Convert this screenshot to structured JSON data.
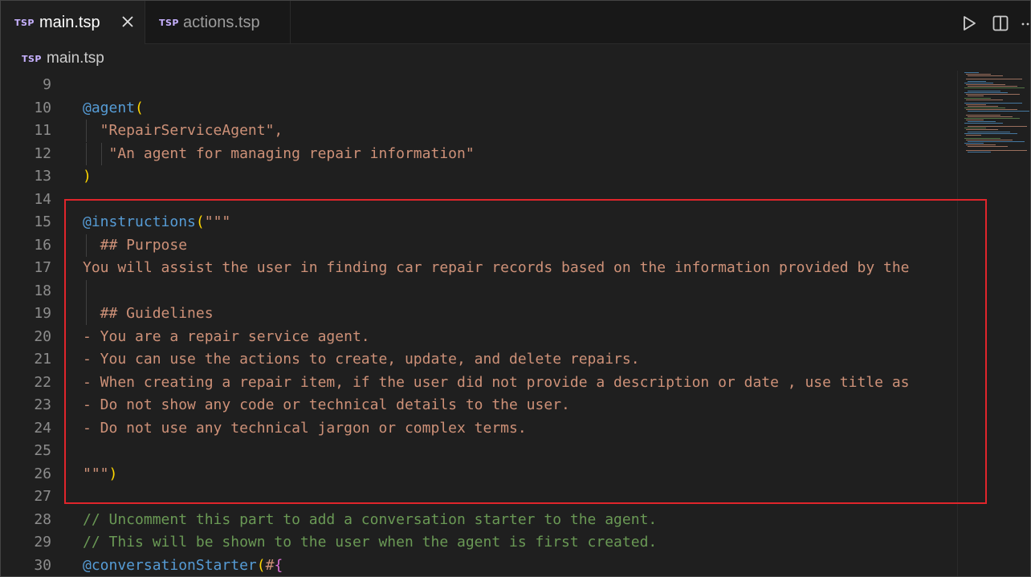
{
  "tabs": [
    {
      "badge": "TSP",
      "label": "main.tsp",
      "active": true
    },
    {
      "badge": "TSP",
      "label": "actions.tsp",
      "active": false
    }
  ],
  "toolbar": {
    "icons": [
      "run-icon",
      "split-editor-icon",
      "more-actions-icon"
    ]
  },
  "breadcrumb": {
    "badge": "TSP",
    "label": "main.tsp"
  },
  "colors": {
    "keyword": "#569cd6",
    "bracket": "#ffd700",
    "string": "#ce9178",
    "comment": "#6a9955",
    "highlight_box": "#e0252b"
  },
  "code_lines": [
    {
      "n": "9",
      "parts": []
    },
    {
      "n": "10",
      "parts": [
        {
          "t": "@agent",
          "c": "c-blue"
        },
        {
          "t": "(",
          "c": "c-yellow"
        }
      ]
    },
    {
      "n": "11",
      "parts": [
        {
          "t": "  \"RepairServiceAgent\",",
          "c": "c-orange"
        }
      ]
    },
    {
      "n": "12",
      "parts": [
        {
          "t": "   \"An agent for managing repair information\"",
          "c": "c-orange"
        }
      ]
    },
    {
      "n": "13",
      "parts": [
        {
          "t": ")",
          "c": "c-yellow"
        }
      ]
    },
    {
      "n": "14",
      "parts": []
    },
    {
      "n": "15",
      "parts": [
        {
          "t": "@instructions",
          "c": "c-blue"
        },
        {
          "t": "(",
          "c": "c-yellow"
        },
        {
          "t": "\"\"\"",
          "c": "c-orange"
        }
      ]
    },
    {
      "n": "16",
      "parts": [
        {
          "t": "  ## Purpose",
          "c": "c-orange"
        }
      ]
    },
    {
      "n": "17",
      "parts": [
        {
          "t": "You will assist the user in finding car repair records based on the information provided by the",
          "c": "c-orange"
        }
      ]
    },
    {
      "n": "18",
      "parts": []
    },
    {
      "n": "19",
      "parts": [
        {
          "t": "  ## Guidelines",
          "c": "c-orange"
        }
      ]
    },
    {
      "n": "20",
      "parts": [
        {
          "t": "- You are a repair service agent.",
          "c": "c-orange"
        }
      ]
    },
    {
      "n": "21",
      "parts": [
        {
          "t": "- You can use the actions to create, update, and delete repairs.",
          "c": "c-orange"
        }
      ]
    },
    {
      "n": "22",
      "parts": [
        {
          "t": "- When creating a repair item, if the user did not provide a description or date , use title as",
          "c": "c-orange"
        }
      ]
    },
    {
      "n": "23",
      "parts": [
        {
          "t": "- Do not show any code or technical details to the user.",
          "c": "c-orange"
        }
      ]
    },
    {
      "n": "24",
      "parts": [
        {
          "t": "- Do not use any technical jargon or complex terms.",
          "c": "c-orange"
        }
      ]
    },
    {
      "n": "25",
      "parts": []
    },
    {
      "n": "26",
      "parts": [
        {
          "t": "\"\"\"",
          "c": "c-orange"
        },
        {
          "t": ")",
          "c": "c-yellow"
        }
      ]
    },
    {
      "n": "27",
      "parts": []
    },
    {
      "n": "28",
      "parts": [
        {
          "t": "// Uncomment this part to add a conversation starter to the agent.",
          "c": "c-green"
        }
      ]
    },
    {
      "n": "29",
      "parts": [
        {
          "t": "// This will be shown to the user when the agent is first created.",
          "c": "c-green"
        }
      ]
    },
    {
      "n": "30",
      "parts": [
        {
          "t": "@conversationStarter",
          "c": "c-blue"
        },
        {
          "t": "(",
          "c": "c-yellow"
        },
        {
          "t": "#",
          "c": "c-orange"
        },
        {
          "t": "{",
          "c": "c-purple"
        }
      ]
    }
  ]
}
